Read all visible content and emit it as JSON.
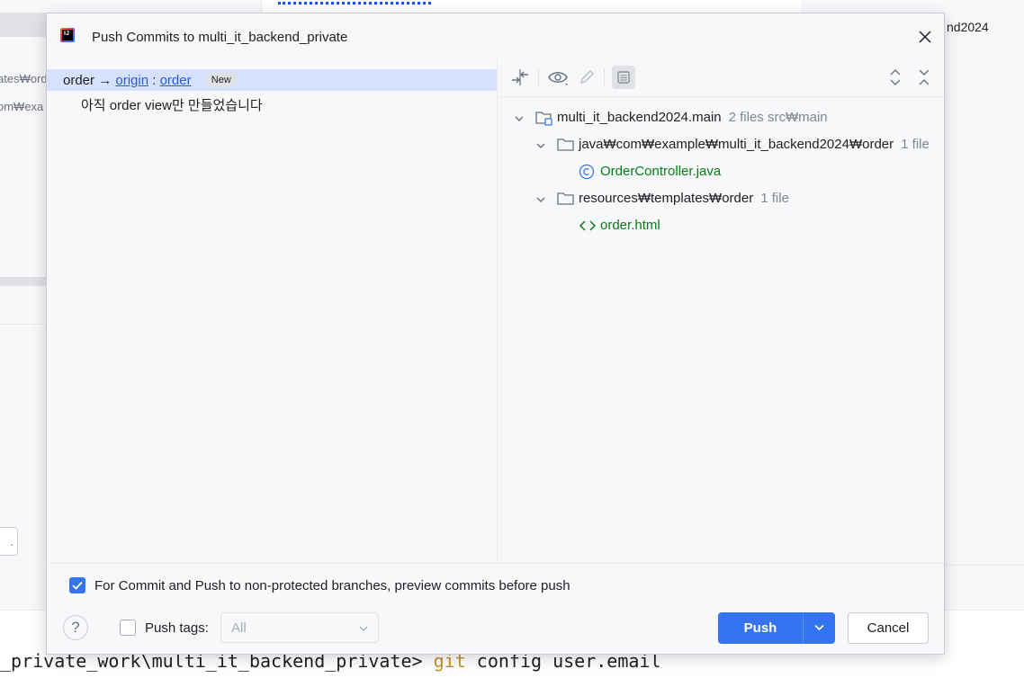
{
  "background": {
    "left_text_1": "ates₩ord",
    "left_text_2": "om₩exa",
    "left_button_text": ".",
    "right_text": "nd2024",
    "terminal_path": "_private_work\\multi_it_backend_private> ",
    "terminal_cmd_git": "git",
    "terminal_cmd_rest": " config user.email"
  },
  "dialog": {
    "title": "Push Commits to multi_it_backend_private",
    "branch": {
      "local": "order",
      "arrow": "→",
      "remote": "origin",
      "sep": ":",
      "remote_branch": "order",
      "badge": "New"
    },
    "commit_message": "아직 order view만 만들었습니다",
    "tree": {
      "module": "multi_it_backend2024.main",
      "module_meta": "2 files  src₩main",
      "folder1": "java₩com₩example₩multi_it_backend2024₩order",
      "folder1_meta": "1 file",
      "file1": "OrderController.java",
      "folder2": "resources₩templates₩order",
      "folder2_meta": "1 file",
      "file2": "order.html"
    },
    "footer": {
      "preview_label": "For Commit and Push to non-protected branches, preview commits before push",
      "preview_checked": true,
      "push_tags_label": "Push tags:",
      "push_tags_checked": false,
      "tags_value": "All",
      "push_label": "Push",
      "cancel_label": "Cancel",
      "help_label": "?"
    }
  },
  "colors": {
    "accent": "#3574f0",
    "link": "#2a5ad6",
    "selection": "#d5e1ff",
    "file_new": "#067d17"
  }
}
